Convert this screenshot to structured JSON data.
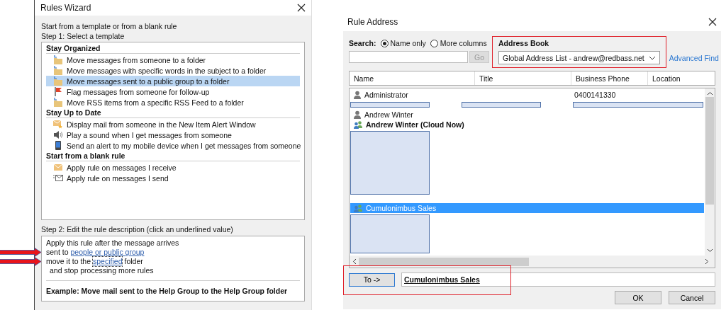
{
  "rules_wizard": {
    "title": "Rules Wizard",
    "intro": "Start from a template or from a blank rule",
    "step1_label": "Step 1: Select a template",
    "groups": [
      {
        "heading": "Stay Organized",
        "items": [
          {
            "label": "Move messages from someone to a folder",
            "kind": "move",
            "selected": false
          },
          {
            "label": "Move messages with specific words in the subject to a folder",
            "kind": "move",
            "selected": false
          },
          {
            "label": "Move messages sent to a public group to a folder",
            "kind": "move",
            "selected": true
          },
          {
            "label": "Flag messages from someone for follow-up",
            "kind": "flag",
            "selected": false
          },
          {
            "label": "Move RSS items from a specific RSS Feed to a folder",
            "kind": "move",
            "selected": false
          }
        ]
      },
      {
        "heading": "Stay Up to Date",
        "items": [
          {
            "label": "Display mail from someone in the New Item Alert Window",
            "kind": "alert",
            "selected": false
          },
          {
            "label": "Play a sound when I get messages from someone",
            "kind": "sound",
            "selected": false
          },
          {
            "label": "Send an alert to my mobile device when I get messages from someone",
            "kind": "mobile",
            "selected": false
          }
        ]
      },
      {
        "heading": "Start from a blank rule",
        "items": [
          {
            "label": "Apply rule on messages I receive",
            "kind": "receive",
            "selected": false
          },
          {
            "label": "Apply rule on messages I send",
            "kind": "send",
            "selected": false
          }
        ]
      }
    ],
    "step2_label": "Step 2: Edit the rule description (click an underlined value)",
    "description": [
      {
        "indented": false,
        "annotated": false,
        "segments": [
          {
            "kind": "text",
            "text": "Apply this rule after the message arrives"
          }
        ]
      },
      {
        "indented": false,
        "annotated": true,
        "segments": [
          {
            "kind": "text",
            "text": "sent to"
          },
          {
            "kind": "link",
            "text": "people or public group",
            "focused": false
          }
        ]
      },
      {
        "indented": false,
        "annotated": true,
        "segments": [
          {
            "kind": "text",
            "text": "move it to the"
          },
          {
            "kind": "link",
            "text": "specified",
            "focused": true
          },
          {
            "kind": "text",
            "text": "folder"
          }
        ]
      },
      {
        "indented": true,
        "annotated": false,
        "segments": [
          {
            "kind": "text",
            "text": "and stop processing more rules"
          }
        ]
      }
    ],
    "example": "Example: Move mail sent to the Help Group to the Help Group folder"
  },
  "rule_address": {
    "title": "Rule Address",
    "search_label": "Search:",
    "search_options": [
      {
        "label": "Name only",
        "selected": true
      },
      {
        "label": "More columns",
        "selected": false
      }
    ],
    "go_button": {
      "label": "Go",
      "disabled": true
    },
    "address_book": {
      "label": "Address Book",
      "value": "Global Address List - andrew@redbass.net",
      "highlighted": true
    },
    "advanced_find": "Advanced Find",
    "columns": [
      "Name",
      "Title",
      "Business Phone",
      "Location"
    ],
    "rows": [
      {
        "kind": "user",
        "name": "Administrator",
        "phone": "0400141330",
        "selected": false
      },
      {
        "kind": "redacted-row"
      },
      {
        "kind": "user",
        "name": "Andrew Winter",
        "selected": false
      },
      {
        "kind": "group",
        "name": "Andrew Winter (Cloud Now)",
        "bold": true,
        "selected": false
      },
      {
        "kind": "redacted-tall"
      },
      {
        "kind": "group",
        "name": "Cumulonimbus Sales",
        "bold": false,
        "selected": true
      },
      {
        "kind": "redacted-short"
      }
    ],
    "to_button": "To ->",
    "to_value": "Cumulonimbus Sales",
    "to_highlighted": true,
    "buttons": [
      "OK",
      "Cancel"
    ]
  }
}
